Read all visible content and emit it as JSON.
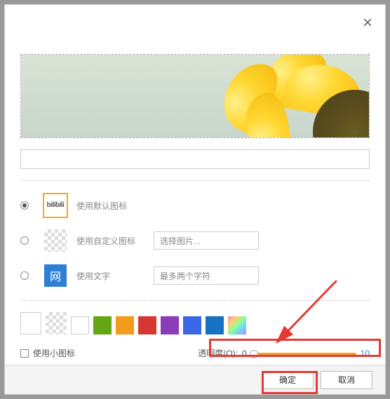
{
  "options": {
    "default_icon_label": "使用默认图标",
    "custom_icon_label": "使用自定义图标",
    "text_icon_label": "使用文字",
    "bili_text": "bilibili",
    "wang_char": "网"
  },
  "inputs": {
    "select_image_label": "选择图片...",
    "max_chars_placeholder": "最多两个字符"
  },
  "swatches": [
    "#64a616",
    "#f29b1d",
    "#d63831",
    "#8b3cb8",
    "#3a67e6",
    "#1971c2"
  ],
  "small_icon_label": "使用小图标",
  "transparency": {
    "label": "透明度(O):",
    "min": "0",
    "max": "10"
  },
  "buttons": {
    "ok": "确定",
    "cancel": "取消"
  }
}
